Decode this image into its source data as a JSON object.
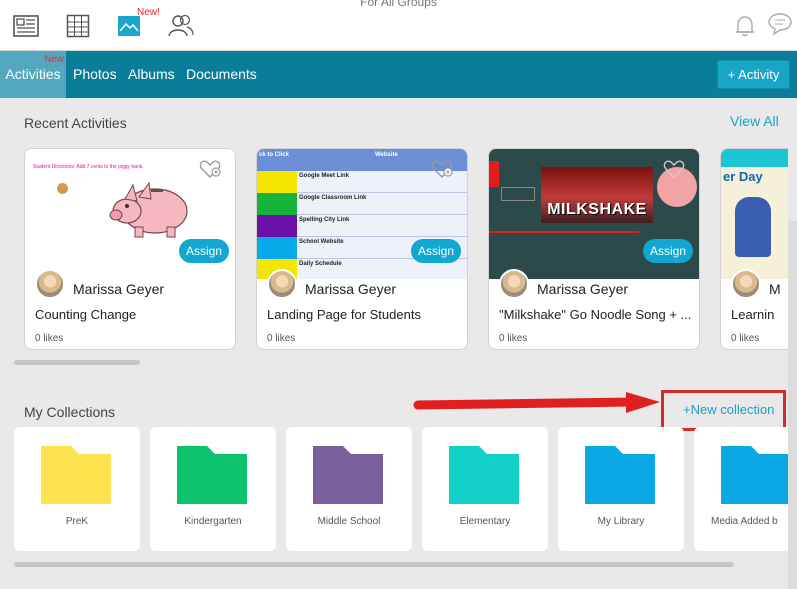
{
  "header": {
    "group_title": "For All Groups",
    "new_badge": "New!",
    "icons": [
      "newsfeed-icon",
      "calendar-grid-icon",
      "photos-icon",
      "people-icon",
      "bell-icon",
      "chat-icon"
    ]
  },
  "nav": {
    "tabs": [
      {
        "label": "Activities",
        "active": true,
        "badge": "New"
      },
      {
        "label": "Photos",
        "active": false
      },
      {
        "label": "Albums",
        "active": false
      },
      {
        "label": "Documents",
        "active": false
      }
    ],
    "add_button": "+ Activity"
  },
  "recent": {
    "title": "Recent Activities",
    "view_all": "View All",
    "assign_label": "Assign",
    "cards": [
      {
        "author": "Marissa Geyer",
        "title": "Counting Change",
        "likes": "0 likes",
        "thumb_text": "Student Directions: Add 7 cents to the piggy bank."
      },
      {
        "author": "Marissa Geyer",
        "title": "Landing Page for Students",
        "likes": "0 likes",
        "thumb_header": [
          "ck to Click",
          "Website"
        ],
        "thumb_rows": [
          "Google Meet Link",
          "Google Classroom Link",
          "Spelling City Link",
          "School Website",
          "Daily Schedule"
        ]
      },
      {
        "author": "Marissa Geyer",
        "title": "\"Milkshake\" Go Noodle Song + ...",
        "likes": "0 likes",
        "thumb_word": "MILKSHAKE"
      },
      {
        "author": "M",
        "title": "Learnin",
        "likes": "0 likes",
        "thumb_text": "er Day"
      }
    ]
  },
  "collections": {
    "title": "My Collections",
    "new_collection": "+New collection",
    "items": [
      {
        "label": "PreK",
        "color": "#fde34e"
      },
      {
        "label": "Kindergarten",
        "color": "#0bc36c"
      },
      {
        "label": "Middle School",
        "color": "#7a5f9a"
      },
      {
        "label": "Elementary",
        "color": "#12d1c9"
      },
      {
        "label": "My Library",
        "color": "#0aa9e6"
      },
      {
        "label": "Media Added b",
        "color": "#0aa9e6"
      }
    ]
  },
  "colors": {
    "nav": "#0a7e98",
    "accent": "#1aa3c4",
    "highlight": "#d42a2a"
  }
}
